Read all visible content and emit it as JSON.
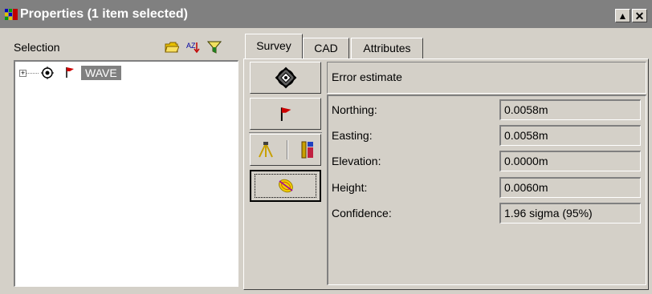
{
  "window": {
    "title": "Properties (1 item selected)",
    "restore_glyph": "▲",
    "close_glyph": "✕"
  },
  "selection": {
    "label": "Selection",
    "icons": [
      "folder-icon",
      "sort-az-icon",
      "filter-icon"
    ],
    "sort_label": "AZ",
    "tree": [
      {
        "label": "WAVE",
        "expander": "+",
        "icons": [
          "target-icon",
          "flag-icon"
        ]
      }
    ]
  },
  "tabs": [
    {
      "label": "Survey",
      "active": true
    },
    {
      "label": "CAD",
      "active": false
    },
    {
      "label": "Attributes",
      "active": false
    }
  ],
  "side_buttons": [
    "survey-point-icon",
    "flag-icon",
    "tripod-icon",
    "instrument-icon",
    "error-ellipse-icon"
  ],
  "detail": {
    "header": "Error estimate",
    "fields": [
      {
        "label": "Northing:",
        "value": "0.0058m"
      },
      {
        "label": "Easting:",
        "value": "0.0058m"
      },
      {
        "label": "Elevation:",
        "value": "0.0000m"
      },
      {
        "label": "Height:",
        "value": "0.0060m"
      },
      {
        "label": "Confidence:",
        "value": "1.96 sigma (95%)"
      }
    ]
  },
  "colors": {
    "face": "#d4d0c8",
    "titlebar": "#808080",
    "highlight": "#808080",
    "flag": "#cc0000"
  }
}
